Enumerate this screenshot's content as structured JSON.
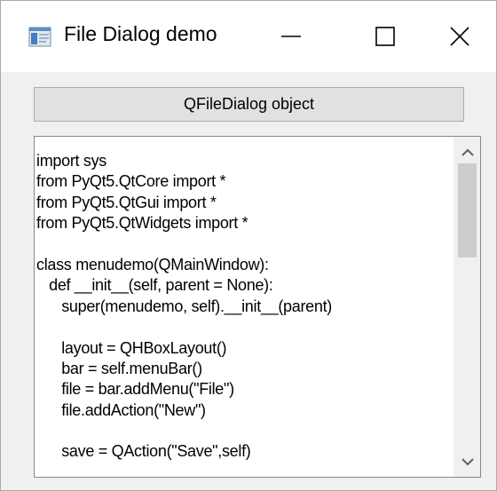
{
  "window": {
    "title": "File Dialog demo",
    "controls": {
      "minimize_icon": "minimize-icon",
      "maximize_icon": "maximize-icon",
      "close_icon": "close-icon"
    }
  },
  "main": {
    "button_label": "QFileDialog object",
    "editor_lines": [
      "import sys",
      "from PyQt5.QtCore import *",
      "from PyQt5.QtGui import *",
      "from PyQt5.QtWidgets import *",
      "",
      "class menudemo(QMainWindow):",
      "   def __init__(self, parent = None):",
      "      super(menudemo, self).__init__(parent)",
      "",
      "      layout = QHBoxLayout()",
      "      bar = self.menuBar()",
      "      file = bar.addMenu(\"File\")",
      "      file.addAction(\"New\")",
      "",
      "      save = QAction(\"Save\",self)"
    ]
  },
  "colors": {
    "window_bg": "#f0f0f0",
    "titlebar_bg": "#ffffff",
    "button_bg": "#e1e1e1",
    "scroll_thumb": "#cdcdcd"
  }
}
